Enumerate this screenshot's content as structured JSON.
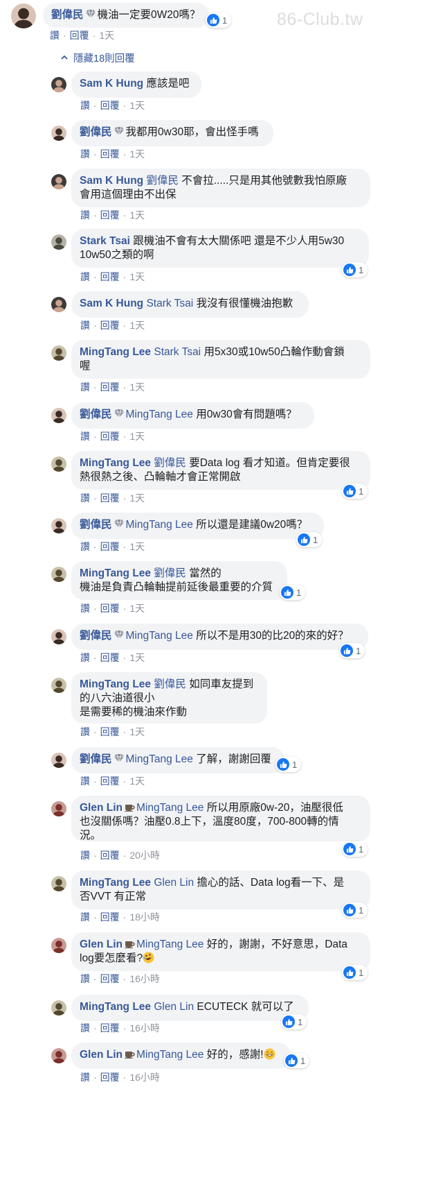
{
  "watermark": "86-Club.tw",
  "ui": {
    "like_label": "讚",
    "reply_label": "回覆",
    "separator": "·",
    "hide_replies": "隱藏18則回覆"
  },
  "colors": {
    "link": "#385898",
    "bubble": "#f2f3f5",
    "meta": "#90949c",
    "like_blue": "#1877f2"
  },
  "top": {
    "author": "劉偉民",
    "badge": "gem-icon",
    "mention": "",
    "text": "機油一定要0W20嗎？",
    "time": "1天",
    "likes": "1"
  },
  "replies": [
    {
      "author": "Sam K Hung",
      "badge": "",
      "mention": "",
      "lines": [
        "應該是吧"
      ],
      "time": "1天",
      "likes": ""
    },
    {
      "author": "劉偉民",
      "badge": "gem-icon",
      "mention": "",
      "lines": [
        "我都用0w30耶，會出怪手嗎"
      ],
      "time": "1天",
      "likes": ""
    },
    {
      "author": "Sam K Hung",
      "badge": "",
      "mention": "劉偉民",
      "lines": [
        "不會拉.....只是用其他號數我怕原廠",
        "會用這個理由不出保"
      ],
      "time": "1天",
      "likes": ""
    },
    {
      "author": "Stark Tsai",
      "badge": "",
      "mention": "",
      "lines": [
        "跟機油不會有太大關係吧 還是不少人用5w30",
        "10w50之類的啊"
      ],
      "time": "1天",
      "likes": "1"
    },
    {
      "author": "Sam K Hung",
      "badge": "",
      "mention": "Stark Tsai",
      "lines": [
        "我沒有很懂機油抱歉"
      ],
      "time": "1天",
      "likes": ""
    },
    {
      "author": "MingTang Lee",
      "badge": "",
      "mention": "Stark Tsai",
      "lines": [
        "用5x30或10w50凸輪作動會鎖",
        "喔"
      ],
      "time": "1天",
      "likes": ""
    },
    {
      "author": "劉偉民",
      "badge": "gem-icon",
      "mention": "MingTang Lee",
      "lines": [
        "用0w30會有問題嗎？"
      ],
      "time": "1天",
      "likes": ""
    },
    {
      "author": "MingTang Lee",
      "badge": "",
      "mention": "劉偉民",
      "lines": [
        "要Data log 看才知道。但肯定要很",
        "熱很熱之後、凸輪軸才會正常開啟"
      ],
      "time": "1天",
      "likes": "1"
    },
    {
      "author": "劉偉民",
      "badge": "gem-icon",
      "mention": "MingTang Lee",
      "lines": [
        "所以還是建議0w20嗎？"
      ],
      "time": "1天",
      "likes": "1"
    },
    {
      "author": "MingTang Lee",
      "badge": "",
      "mention": "劉偉民",
      "lines": [
        "當然的",
        "機油是負責凸輪軸提前延後最重要的介質"
      ],
      "time": "1天",
      "likes": "1"
    },
    {
      "author": "劉偉民",
      "badge": "gem-icon",
      "mention": "MingTang Lee",
      "lines": [
        "所以不是用30的比20的來的好？"
      ],
      "time": "1天",
      "likes": "1"
    },
    {
      "author": "MingTang Lee",
      "badge": "",
      "mention": "劉偉民",
      "lines": [
        "如同車友提到",
        "的八六油道很小",
        "是需要稀的機油來作動"
      ],
      "time": "1天",
      "likes": ""
    },
    {
      "author": "劉偉民",
      "badge": "gem-icon",
      "mention": "MingTang Lee",
      "lines": [
        "了解，謝謝回覆"
      ],
      "time": "1天",
      "likes": "1"
    },
    {
      "author": "Glen Lin",
      "badge": "cup-icon",
      "mention": "MingTang Lee",
      "lines": [
        "所以用原廠0w-20，油壓很低",
        "也沒關係嗎？油壓0.8上下，溫度80度，700-800轉的情",
        "況。"
      ],
      "time": "20小時",
      "likes": "1"
    },
    {
      "author": "MingTang Lee",
      "badge": "",
      "mention": "Glen Lin",
      "lines": [
        "擔心的話、Data log看一下、是",
        "否VVT 有正常"
      ],
      "time": "18小時",
      "likes": "1"
    },
    {
      "author": "Glen Lin",
      "badge": "cup-icon",
      "mention": "MingTang Lee",
      "lines": [
        "好的，謝謝，不好意思，Data",
        "log要怎麼看?"
      ],
      "emoji": "rofl-emoji",
      "time": "16小時",
      "likes": "1"
    },
    {
      "author": "MingTang Lee",
      "badge": "",
      "mention": "Glen Lin",
      "lines": [
        "ECUTECK 就可以了"
      ],
      "time": "16小時",
      "likes": "1"
    },
    {
      "author": "Glen Lin",
      "badge": "cup-icon",
      "mention": "MingTang Lee",
      "lines": [
        "好的，感謝!"
      ],
      "emoji": "grin-emoji",
      "time": "16小時",
      "likes": "1"
    }
  ]
}
